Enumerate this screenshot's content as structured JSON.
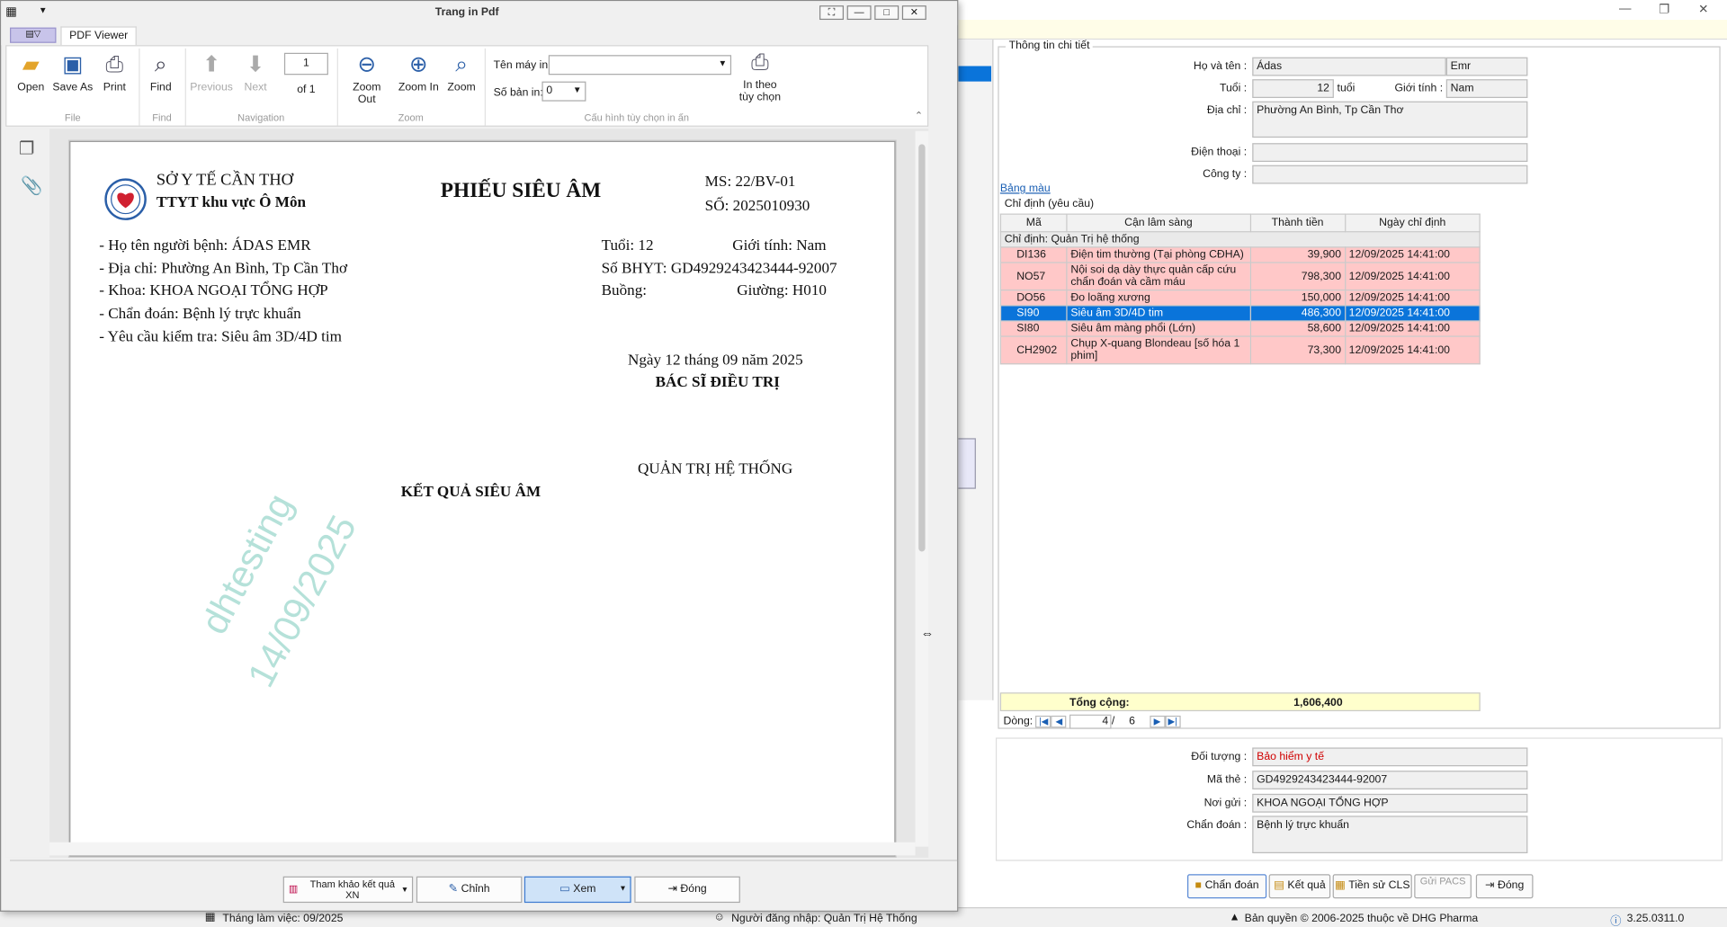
{
  "main_window": {
    "detail_title": "Thông tin chi tiết",
    "ho_ten_label": "Họ và tên :",
    "ho": "Ádas",
    "ten": "Emr",
    "tuoi_label": "Tuổi :",
    "tuoi": "12",
    "tuoi_unit": "tuổi",
    "gioi_tinh_label": "Giới tính :",
    "gioi_tinh": "Nam",
    "dia_chi_label": "Địa chỉ :",
    "dia_chi": "Phường An Bình, Tp Cần Thơ",
    "dien_thoai_label": "Điện thoại :",
    "dien_thoai": "",
    "cong_ty_label": "Công ty :",
    "cong_ty": "",
    "bang_mau": "Bảng màu",
    "chi_dinh_title": "Chỉ định (yêu cầu)",
    "columns": [
      "Mã",
      "Cận lâm sàng",
      "Thành tiền",
      "Ngày chỉ định"
    ],
    "group_label": "Chỉ định:  Quản Trị hệ thống",
    "rows": [
      {
        "ma": "DI136",
        "cls": "Điện tim thường (Tại phòng CĐHA)",
        "tien": "39,900",
        "ngay": "12/09/2025 14:41:00"
      },
      {
        "ma": "NO57",
        "cls": "Nội soi dạ dày thực quản cấp cứu chẩn đoán và cầm máu",
        "tien": "798,300",
        "ngay": "12/09/2025 14:41:00"
      },
      {
        "ma": "DO56",
        "cls": "Đo loãng xương",
        "tien": "150,000",
        "ngay": "12/09/2025 14:41:00"
      },
      {
        "ma": "SI90",
        "cls": "Siêu âm 3D/4D tim",
        "tien": "486,300",
        "ngay": "12/09/2025 14:41:00"
      },
      {
        "ma": "SI80",
        "cls": "Siêu âm màng phổi (Lớn)",
        "tien": "58,600",
        "ngay": "12/09/2025 14:41:00"
      },
      {
        "ma": "CH2902",
        "cls": "Chụp X-quang Blondeau [số hóa 1 phim]",
        "tien": "73,300",
        "ngay": "12/09/2025 14:41:00"
      }
    ],
    "tong_cong_label": "Tổng cộng:",
    "tong_cong": "1,606,400",
    "dong_label": "Dòng:",
    "dong_current": "4",
    "dong_sep": "/",
    "dong_total": "6",
    "doi_tuong_label": "Đối tượng :",
    "doi_tuong": "Bảo hiểm y tế",
    "ma_the_label": "Mã thẻ :",
    "ma_the": "GD4929243423444-92007",
    "noi_gui_label": "Nơi gửi :",
    "noi_gui": "KHOA NGOẠI TỔNG HỢP",
    "chan_doan_label": "Chẩn đoán :",
    "chan_doan": "Bệnh lý trực khuẩn",
    "buttons": {
      "chan_doan": "Chẩn đoán",
      "ket_qua": "Kết quả",
      "tien_su": "Tiền sử CLS",
      "gui_pacs": "Gửi PACS",
      "dong": "Đóng"
    }
  },
  "status_bar": {
    "thang": "Tháng làm việc: 09/2025",
    "nguoi": "Người đăng nhập: Quản Trị Hệ Thống",
    "ban_quyen": "Bản quyền © 2006-2025 thuộc về DHG Pharma",
    "version": "3.25.0311.0"
  },
  "pdf_window": {
    "title": "Trang in Pdf",
    "tab": "PDF Viewer",
    "ribbon": {
      "open": "Open",
      "save_as": "Save As",
      "print": "Print",
      "find": "Find",
      "previous": "Previous",
      "next": "Next",
      "page": "1",
      "of": "of 1",
      "zoom_out": "Zoom Out",
      "zoom_in": "Zoom In",
      "zoom": "Zoom",
      "ten_may_in": "Tên máy in:",
      "so_ban_in": "Số bản in:",
      "so_ban_value": "0",
      "in_theo": "In theo",
      "tuy_chon": "tùy chọn",
      "groups": {
        "file": "File",
        "find": "Find",
        "navigation": "Navigation",
        "zoom": "Zoom",
        "cauhinh": "Cấu hình tùy chọn in ấn"
      }
    },
    "document": {
      "so_y_te": "SỞ Y TẾ CẦN THƠ",
      "ttyt": "TTYT khu vực Ô Môn",
      "title": "PHIẾU SIÊU ÂM",
      "ms": "MS: 22/BV-01",
      "so": "SỐ: 2025010930",
      "ho_ten": "- Họ tên người bệnh: ÁDAS EMR",
      "dia_chi": "- Địa chỉ: Phường An Bình, Tp Cần Thơ",
      "khoa": "- Khoa: KHOA NGOẠI TỔNG HỢP",
      "chan_doan": "- Chẩn đoán: Bệnh lý trực khuẩn",
      "yeu_cau": "- Yêu cầu kiểm tra: Siêu âm 3D/4D tim",
      "tuoi": "Tuổi: 12",
      "gioi_tinh": "Giới tính: Nam",
      "bhyt": "Số BHYT: GD4929243423444-92007",
      "buong": "Buồng:",
      "giuong": "Giường: H010",
      "ngay": "Ngày 12 tháng 09 năm 2025",
      "bac_si": "BÁC SĨ ĐIỀU TRỊ",
      "quan_tri": "QUẢN TRỊ HỆ THỐNG",
      "ket_qua": "KẾT QUẢ SIÊU ÂM",
      "wm1": "dhtesting",
      "wm2": "14/09/2025"
    },
    "bottom": {
      "tham_khao": "Tham khảo kết quả XN",
      "chinh": "Chỉnh",
      "xem": "Xem",
      "dong": "Đóng"
    }
  }
}
